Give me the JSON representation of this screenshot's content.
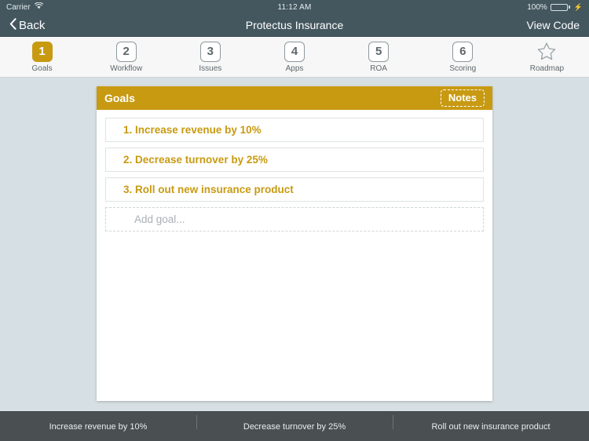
{
  "status_bar": {
    "carrier": "Carrier",
    "wifi_icon": "wifi-icon",
    "time": "11:12 AM",
    "battery_percent": "100%",
    "battery_icon": "battery-full-icon",
    "charging_icon": "charging-bolt-icon"
  },
  "nav_bar": {
    "back_icon": "chevron-left-icon",
    "back_label": "Back",
    "title": "Protectus Insurance",
    "right_label": "View Code"
  },
  "tabs": [
    {
      "number": "1",
      "label": "Goals",
      "active": true,
      "icon": "number-badge-1"
    },
    {
      "number": "2",
      "label": "Workflow",
      "active": false,
      "icon": "number-badge-2"
    },
    {
      "number": "3",
      "label": "Issues",
      "active": false,
      "icon": "number-badge-3"
    },
    {
      "number": "4",
      "label": "Apps",
      "active": false,
      "icon": "number-badge-4"
    },
    {
      "number": "5",
      "label": "ROA",
      "active": false,
      "icon": "number-badge-5"
    },
    {
      "number": "6",
      "label": "Scoring",
      "active": false,
      "icon": "number-badge-6"
    },
    {
      "number": "",
      "label": "Roadmap",
      "active": false,
      "icon": "star-outline-icon"
    }
  ],
  "panel": {
    "title": "Goals",
    "notes_label": "Notes",
    "goals": [
      "1. Increase revenue by 10%",
      "2. Decrease turnover by 25%",
      "3. Roll out new insurance product"
    ],
    "add_placeholder": "Add goal..."
  },
  "bottom_bar": {
    "items": [
      "Increase revenue by 10%",
      "Decrease turnover by 25%",
      "Roll out new insurance product"
    ]
  },
  "colors": {
    "accent_gold": "#c89a12",
    "nav_slate": "#44575f",
    "stage_bg": "#d6dfe3",
    "bottom_bar": "#4a4f52",
    "battery_green": "#4cd964"
  }
}
